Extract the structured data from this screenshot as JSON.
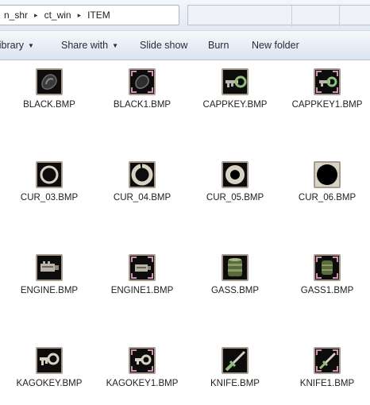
{
  "breadcrumb": {
    "items": [
      "n_shr",
      "ct_win",
      "ITEM"
    ],
    "separator": "▸"
  },
  "toolbar": {
    "items": [
      {
        "label": "library",
        "has_dropdown": true
      },
      {
        "label": "Share with",
        "has_dropdown": true
      },
      {
        "label": "Slide show",
        "has_dropdown": false
      },
      {
        "label": "Burn",
        "has_dropdown": false
      },
      {
        "label": "New folder",
        "has_dropdown": false
      }
    ]
  },
  "files": [
    {
      "name": "BLACK.BMP",
      "icon": "black-blob-icon"
    },
    {
      "name": "BLACK1.BMP",
      "icon": "black-blob-selected-icon"
    },
    {
      "name": "CAPPKEY.BMP",
      "icon": "key-icon"
    },
    {
      "name": "CAPPKEY1.BMP",
      "icon": "key-selected-icon"
    },
    {
      "name": "CUR_03.BMP",
      "icon": "cursor-ring-icon"
    },
    {
      "name": "CUR_04.BMP",
      "icon": "cursor-ring-icon"
    },
    {
      "name": "CUR_05.BMP",
      "icon": "cursor-ring-icon"
    },
    {
      "name": "CUR_06.BMP",
      "icon": "cursor-ring-icon"
    },
    {
      "name": "ENGINE.BMP",
      "icon": "engine-icon"
    },
    {
      "name": "ENGINE1.BMP",
      "icon": "engine-selected-icon"
    },
    {
      "name": "GASS.BMP",
      "icon": "gas-can-icon"
    },
    {
      "name": "GASS1.BMP",
      "icon": "gas-can-selected-icon"
    },
    {
      "name": "KAGOKEY.BMP",
      "icon": "key-icon"
    },
    {
      "name": "KAGOKEY1.BMP",
      "icon": "key-selected-icon"
    },
    {
      "name": "KNIFE.BMP",
      "icon": "knife-icon"
    },
    {
      "name": "KNIFE1.BMP",
      "icon": "knife-selected-icon"
    }
  ],
  "colors": {
    "toolbar_gradient_top": "#f6f9fc",
    "toolbar_gradient_bottom": "#dbe4ef",
    "thumb_frame": "#a79c8e",
    "selection_corner": "#d58fb4"
  }
}
